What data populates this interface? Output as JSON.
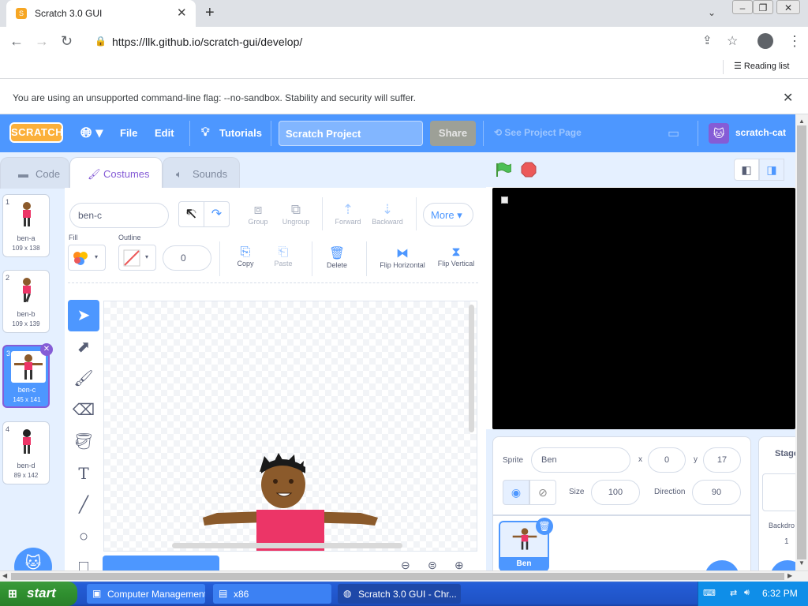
{
  "browser": {
    "tab_title": "Scratch 3.0 GUI",
    "url": "https://llk.github.io/scratch-gui/develop/",
    "reading_list": "Reading list",
    "infobar": "You are using an unsupported command-line flag: --no-sandbox. Stability and security will suffer."
  },
  "scratch": {
    "logo": "SCRATCH",
    "menu": {
      "file": "File",
      "edit": "Edit",
      "tutorials": "Tutorials"
    },
    "project_title": "Scratch Project",
    "share": "Share",
    "see_project_page": "See Project Page",
    "user": "scratch-cat",
    "tabs": {
      "code": "Code",
      "costumes": "Costumes",
      "sounds": "Sounds"
    },
    "costumes": [
      {
        "num": "1",
        "name": "ben-a",
        "size": "109 x 138"
      },
      {
        "num": "2",
        "name": "ben-b",
        "size": "109 x 139"
      },
      {
        "num": "3",
        "name": "ben-c",
        "size": "145 x 141"
      },
      {
        "num": "4",
        "name": "ben-d",
        "size": "89 x 142"
      }
    ],
    "editor": {
      "costume_name": "ben-c",
      "group": "Group",
      "ungroup": "Ungroup",
      "forward": "Forward",
      "backward": "Backward",
      "more": "More",
      "fill": "Fill",
      "outline": "Outline",
      "outline_width": "0",
      "copy": "Copy",
      "paste": "Paste",
      "delete": "Delete",
      "flip_h": "Flip Horizontal",
      "flip_v": "Flip Vertical"
    },
    "sprite": {
      "label": "Sprite",
      "name": "Ben",
      "x_label": "x",
      "x": "0",
      "y_label": "y",
      "y": "17",
      "size_label": "Size",
      "size": "100",
      "direction_label": "Direction",
      "direction": "90",
      "thumb_name": "Ben"
    },
    "stage_pane": {
      "title": "Stage",
      "backdrops": "Backdro",
      "count": "1"
    }
  },
  "taskbar": {
    "start": "start",
    "items": [
      "Computer Management",
      "x86",
      "Scratch 3.0 GUI - Chr..."
    ],
    "clock": "6:32 PM"
  },
  "colors": {
    "scratch_blue": "#4d97ff",
    "costume_purple": "#855cd6",
    "green_flag": "#4cbf56",
    "stop_red": "#ec5959"
  }
}
